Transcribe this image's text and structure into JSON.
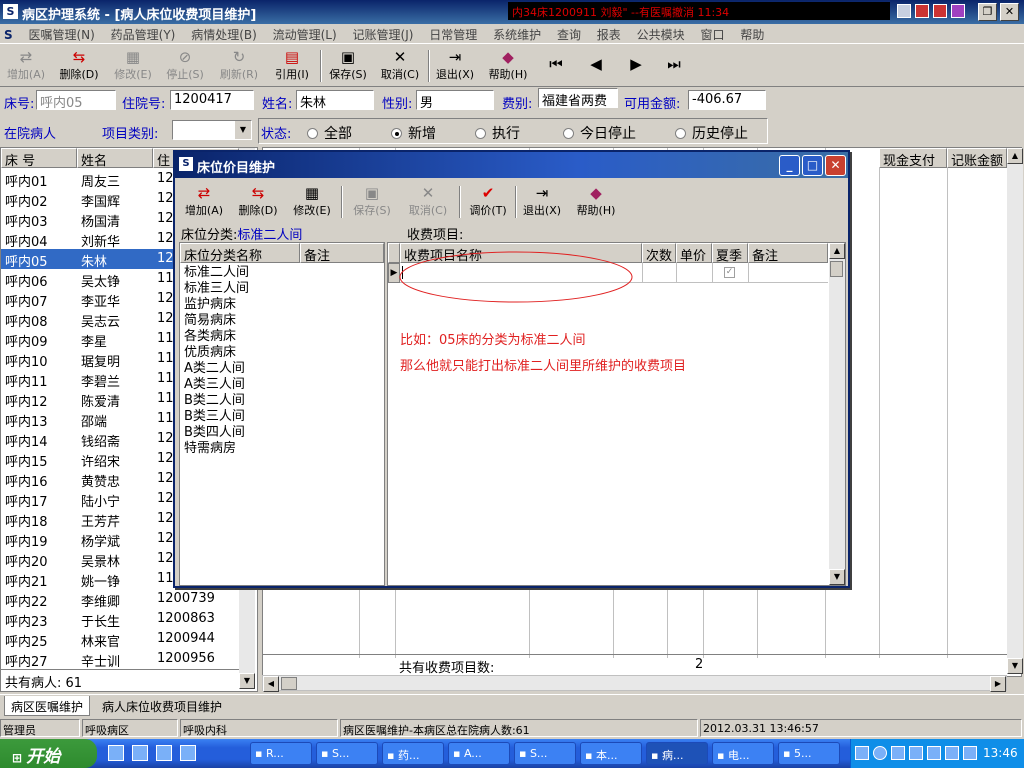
{
  "window": {
    "title": "病区护理系统 - [病人床位收费项目维护]",
    "alert": "内34床1200911 刘毅\" --有医嘱撤消 11:34"
  },
  "menu": [
    "医嘱管理(N)",
    "药品管理(Y)",
    "病情处理(B)",
    "流动管理(L)",
    "记账管理(J)",
    "日常管理",
    "系统维护",
    "查询",
    "报表",
    "公共模块",
    "窗口",
    "帮助"
  ],
  "toolbar": {
    "add": "增加(A)",
    "delete": "删除(D)",
    "edit": "修改(E)",
    "stop": "停止(S)",
    "refresh": "刷新(R)",
    "cite": "引用(I)",
    "save": "保存(S)",
    "cancel": "取消(C)",
    "exit": "退出(X)",
    "help": "帮助(H)"
  },
  "patient": {
    "bed_label": "床号:",
    "bed": "呼内05",
    "admission_label": "住院号:",
    "admission": "1200417",
    "name_label": "姓名:",
    "name": "朱林",
    "sex_label": "性别:",
    "sex": "男",
    "fee_label": "费别:",
    "fee": "福建省两费",
    "balance_label": "可用金额:",
    "balance": "-406.67"
  },
  "filter": {
    "inpatient": "在院病人",
    "category_label": "项目类别:",
    "status_label": "状态:",
    "options": [
      "全部",
      "新增",
      "执行",
      "今日停止",
      "历史停止"
    ],
    "selected": "新增"
  },
  "patient_list": {
    "headers": [
      "床 号",
      "姓名",
      "住"
    ],
    "rows": [
      [
        "呼内01",
        "周友三",
        "12"
      ],
      [
        "呼内02",
        "李国辉",
        "12"
      ],
      [
        "呼内03",
        "杨国清",
        "12"
      ],
      [
        "呼内04",
        "刘新华",
        "12"
      ],
      [
        "呼内05",
        "朱林",
        "12"
      ],
      [
        "呼内06",
        "吴太铮",
        "11"
      ],
      [
        "呼内07",
        "李亚华",
        "12"
      ],
      [
        "呼内08",
        "吴志云",
        "12"
      ],
      [
        "呼内09",
        "李星",
        "11"
      ],
      [
        "呼内10",
        "琚复明",
        "11"
      ],
      [
        "呼内11",
        "李碧兰",
        "11"
      ],
      [
        "呼内12",
        "陈爱清",
        "11"
      ],
      [
        "呼内13",
        "邵端",
        "11"
      ],
      [
        "呼内14",
        "钱绍斋",
        "12"
      ],
      [
        "呼内15",
        "许绍宋",
        "12"
      ],
      [
        "呼内16",
        "黄赞忠",
        "12"
      ],
      [
        "呼内17",
        "陆小宁",
        "12"
      ],
      [
        "呼内18",
        "王芳芹",
        "12"
      ],
      [
        "呼内19",
        "杨学斌",
        "12"
      ],
      [
        "呼内20",
        "吴景林",
        "12"
      ],
      [
        "呼内21",
        "姚一铮",
        "11"
      ],
      [
        "呼内22",
        "李维卿",
        "1200739"
      ],
      [
        "呼内23",
        "于长生",
        "1200863"
      ],
      [
        "呼内25",
        "林来官",
        "1200944"
      ],
      [
        "呼内27",
        "辛士训",
        "1200956"
      ]
    ],
    "selected_index": 4,
    "total_label": "共有病人:",
    "total": "61"
  },
  "main_grid": {
    "headers_visible": [
      "现金支付",
      "记账金额"
    ],
    "footer_label": "共有收费项目数:",
    "footer_count": "2"
  },
  "dialog": {
    "title": "床位价目维护",
    "toolbar": {
      "add": "增加(A)",
      "delete": "删除(D)",
      "edit": "修改(E)",
      "save": "保存(S)",
      "cancel": "取消(C)",
      "price": "调价(T)",
      "exit": "退出(X)",
      "help": "帮助(H)"
    },
    "bed_category_label": "床位分类:",
    "bed_category": "标准二人间",
    "fee_items_label": "收费项目:",
    "cat_headers": [
      "床位分类名称",
      "备注"
    ],
    "categories": [
      "标准二人间",
      "标准三人间",
      "监护病床",
      "简易病床",
      "各类病床",
      "优质病床",
      "A类二人间",
      "A类三人间",
      "B类二人间",
      "B类三人间",
      "B类四人间",
      "特需病房"
    ],
    "fee_headers": [
      "收费项目名称",
      "次数",
      "单价",
      "夏季",
      "备注"
    ],
    "annotation_line1": "比如：05床的分类为标准二人间",
    "annotation_line2": "那么他就只能打出标准二人间里所维护的收费项目"
  },
  "tabs": [
    "病区医嘱维护",
    "病人床位收费项目维护"
  ],
  "statusbar": [
    "管理员",
    "呼吸病区",
    "呼吸内科",
    "病区医嘱维护-本病区总在院病人数:61",
    "2012.03.31 13:46:57"
  ],
  "taskbar": {
    "start": "开始",
    "tasks": [
      "R...",
      "S...",
      "药...",
      "A...",
      "S...",
      "本...",
      "病...",
      "电...",
      "5..."
    ],
    "active_index": 6,
    "clock": "13:46"
  },
  "colors": {
    "title": "#0a246a",
    "selection": "#316ac5",
    "label": "#0000c0",
    "annotation": "#e02020"
  }
}
